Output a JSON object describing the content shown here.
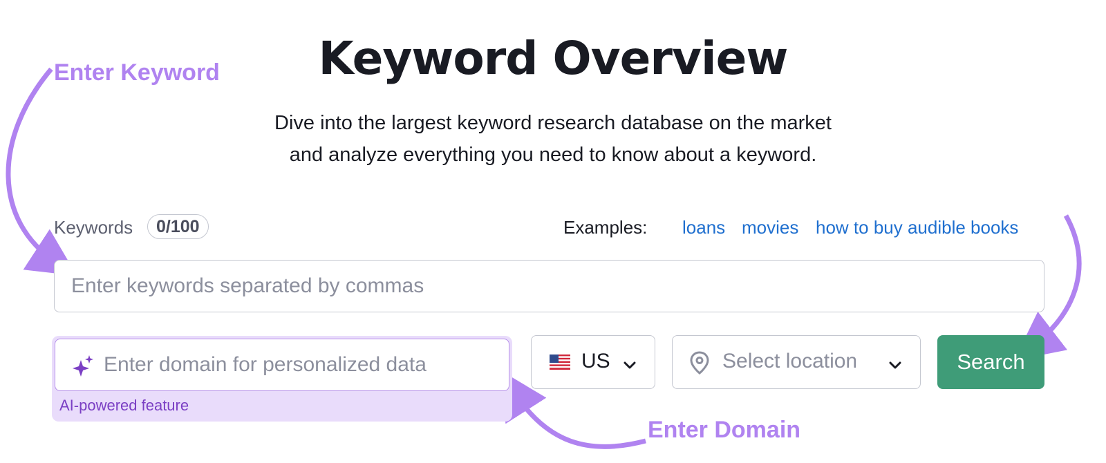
{
  "page": {
    "title": "Keyword Overview",
    "subtitle_line1": "Dive into the largest keyword research database on the market",
    "subtitle_line2": "and analyze everything you need to know about a keyword."
  },
  "keywords": {
    "label": "Keywords",
    "counter": "0/100",
    "placeholder": "Enter keywords separated by commas",
    "value": ""
  },
  "examples": {
    "label": "Examples:",
    "items": [
      "loans",
      "movies",
      "how to buy audible books"
    ]
  },
  "domain": {
    "placeholder": "Enter domain for personalized data",
    "note": "AI-powered feature",
    "icon": "sparkle-icon"
  },
  "country": {
    "code": "US",
    "flag_icon": "us-flag-icon"
  },
  "location": {
    "placeholder": "Select location",
    "icon": "location-pin-icon"
  },
  "search": {
    "label": "Search"
  },
  "annotations": {
    "keyword": "Enter Keyword",
    "domain": "Enter Domain"
  },
  "colors": {
    "accent_green": "#3f9c78",
    "annotation_purple": "#b083f0",
    "link_blue": "#1f6fcf",
    "ai_purple": "#7b3fc4",
    "ai_bg": "#e9dcfb"
  }
}
